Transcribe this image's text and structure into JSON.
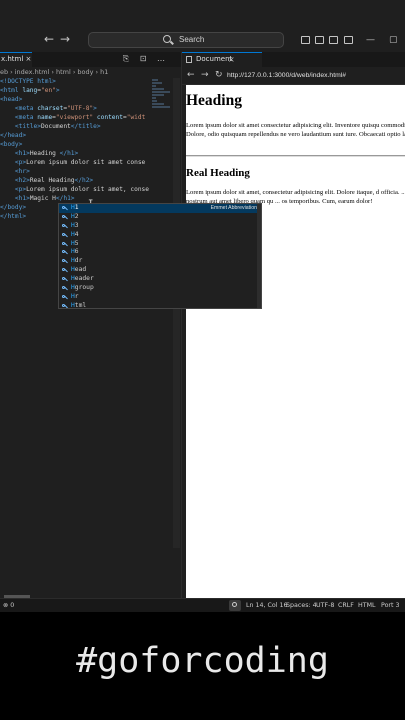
{
  "titlebar": {
    "back": "←",
    "forward": "→",
    "search_label": "Search",
    "window_min": "—",
    "window_max": "▢"
  },
  "editor": {
    "tab_label": "x.html ×",
    "breadcrumb": [
      "eb",
      "›",
      "index.html",
      "›",
      "html",
      "›",
      "body",
      "›",
      "h1"
    ],
    "actions": "⎘ ⊡ …",
    "lines": [
      [
        {
          "t": "<!DOCTYPE ",
          "c": "tag"
        },
        {
          "t": "html",
          "c": "tag"
        },
        {
          "t": ">",
          "c": "tag"
        }
      ],
      [
        {
          "t": "<html ",
          "c": "tag"
        },
        {
          "t": "lang",
          "c": "attr"
        },
        {
          "t": "=",
          "c": "txt"
        },
        {
          "t": "\"en\"",
          "c": "str"
        },
        {
          "t": ">",
          "c": "tag"
        }
      ],
      [
        {
          "t": "<head>",
          "c": "tag"
        }
      ],
      [
        {
          "t": "    <meta ",
          "c": "tag"
        },
        {
          "t": "charset",
          "c": "attr"
        },
        {
          "t": "=",
          "c": "txt"
        },
        {
          "t": "\"UTF-8\"",
          "c": "str"
        },
        {
          "t": ">",
          "c": "tag"
        }
      ],
      [
        {
          "t": "    <meta ",
          "c": "tag"
        },
        {
          "t": "name",
          "c": "attr"
        },
        {
          "t": "=",
          "c": "txt"
        },
        {
          "t": "\"viewport\"",
          "c": "str"
        },
        {
          "t": " content",
          "c": "attr"
        },
        {
          "t": "=",
          "c": "txt"
        },
        {
          "t": "\"widt",
          "c": "str"
        }
      ],
      [
        {
          "t": "    <title>",
          "c": "tag"
        },
        {
          "t": "Document",
          "c": "txt"
        },
        {
          "t": "</title>",
          "c": "tag"
        }
      ],
      [
        {
          "t": "</head>",
          "c": "tag"
        }
      ],
      [
        {
          "t": "<body>",
          "c": "tag"
        }
      ],
      [
        {
          "t": "    <h1>",
          "c": "tag"
        },
        {
          "t": "Heading ",
          "c": "txt"
        },
        {
          "t": "</h1>",
          "c": "tag"
        }
      ],
      [
        {
          "t": "    <p>",
          "c": "tag"
        },
        {
          "t": "Lorem ipsum dolor sit amet conse",
          "c": "txt"
        }
      ],
      [
        {
          "t": "    <hr>",
          "c": "tag"
        }
      ],
      [
        {
          "t": "    <h2>",
          "c": "tag"
        },
        {
          "t": "Real Heading",
          "c": "txt"
        },
        {
          "t": "</h2>",
          "c": "tag"
        }
      ],
      [
        {
          "t": "    <p>",
          "c": "tag"
        },
        {
          "t": "Lorem ipsum dolor sit amet, conse",
          "c": "txt"
        }
      ],
      [
        {
          "t": "    <h1>",
          "c": "tag"
        },
        {
          "t": "Magic H",
          "c": "txt"
        },
        {
          "t": "</h1>",
          "c": "tag"
        }
      ],
      [
        {
          "t": "</body>",
          "c": "tag"
        }
      ],
      [
        {
          "t": "</html>",
          "c": "tag"
        }
      ]
    ]
  },
  "suggest": {
    "detail": "Emmet Abbreviation",
    "items": [
      {
        "match": "H",
        "rest": "1"
      },
      {
        "match": "H",
        "rest": "2"
      },
      {
        "match": "H",
        "rest": "3"
      },
      {
        "match": "H",
        "rest": "4"
      },
      {
        "match": "H",
        "rest": "5"
      },
      {
        "match": "H",
        "rest": "6"
      },
      {
        "match": "H",
        "rest": "dr"
      },
      {
        "match": "H",
        "rest": "ead"
      },
      {
        "match": "H",
        "rest": "eader"
      },
      {
        "match": "H",
        "rest": "group"
      },
      {
        "match": "H",
        "rest": "r"
      },
      {
        "match": "H",
        "rest": "tml"
      }
    ]
  },
  "browser": {
    "tab_label": "Document",
    "tab_close": "×",
    "url": "http://127.0.0.1:3000/d/web/index.html#",
    "page": {
      "h1": "Heading",
      "p1": "Lorem ipsum dolor sit amet consectetur adipisicing elit. Inventore quisqu commodi voluptas vitae similique. Dolore, odio quisquam repellendus ne vero laudantium sunt iure. Obcaecati optio laborum quisquam nisi minim",
      "h2": "Real Heading",
      "p2": "Lorem ipsum dolor sit amet, consectetur adipisicing elit. Dolore itaque, d officia. ... dicta Saepe perspiciatis nostrum aut amet libero quam qu ... os temporibus. Cum, earum dolor!"
    }
  },
  "statusbar": {
    "left": "⊗ 0",
    "position": "Ln 14, Col 16",
    "spaces": "Spaces: 4",
    "encoding": "UTF-8",
    "eol": "CRLF",
    "language": "HTML",
    "port": "Port 3"
  },
  "caption": "#goforcoding"
}
